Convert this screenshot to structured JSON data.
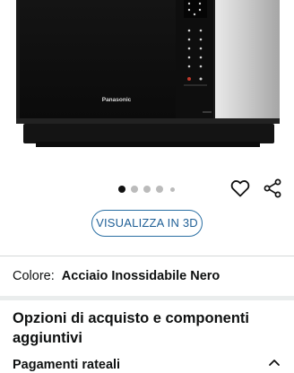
{
  "product": {
    "image_alt": "Panasonic microwave oven, front view",
    "brand_mark": "Panasonic"
  },
  "carousel": {
    "dot_count": 5,
    "active_index": 0
  },
  "actions": {
    "wishlist_icon": "heart-icon",
    "share_icon": "share-icon"
  },
  "view3d": {
    "label": "VISUALIZZA IN 3D"
  },
  "color": {
    "label": "Colore:",
    "value": "Acciaio Inossidabile Nero"
  },
  "purchase_options": {
    "title": "Opzioni di acquisto e componenti aggiuntivi"
  },
  "payments": {
    "label": "Pagamenti rateali",
    "icon": "chevron-up-icon"
  },
  "colors": {
    "link_blue": "#2a6fa3",
    "text": "#0f1111",
    "divider": "#d5d9d9"
  }
}
